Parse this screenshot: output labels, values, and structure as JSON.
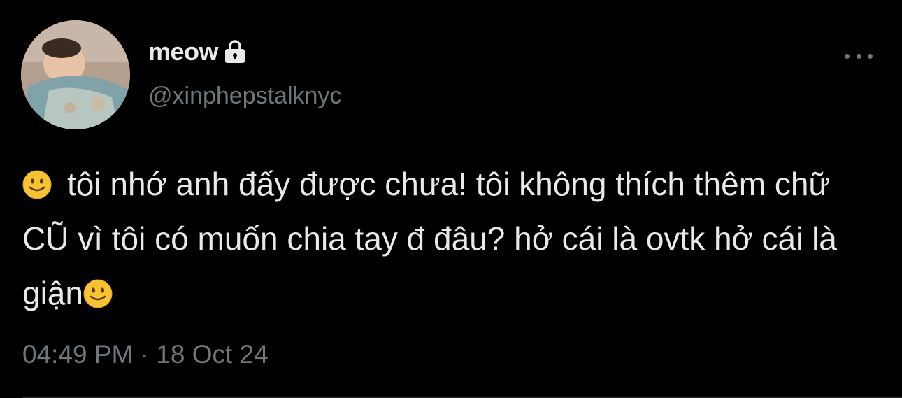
{
  "user": {
    "display_name": "meow",
    "handle": "@xinphepstalknyc",
    "protected": true
  },
  "tweet": {
    "text_part1": "tôi nhớ anh đấy được chưa! tôi không thích thêm chữ CŨ vì tôi có muốn chia tay đ đâu? hở cái là ovtk hở cái là giận",
    "emoji": "slightly-smiling-face",
    "time": "04:49 PM",
    "separator": "·",
    "date": "18 Oct 24"
  },
  "icons": {
    "more": "more-horizontal-icon",
    "lock": "lock-icon"
  },
  "colors": {
    "background": "#000000",
    "primary_text": "#e7e9ea",
    "secondary_text": "#71767b",
    "emoji_face": "#f7c32e"
  }
}
